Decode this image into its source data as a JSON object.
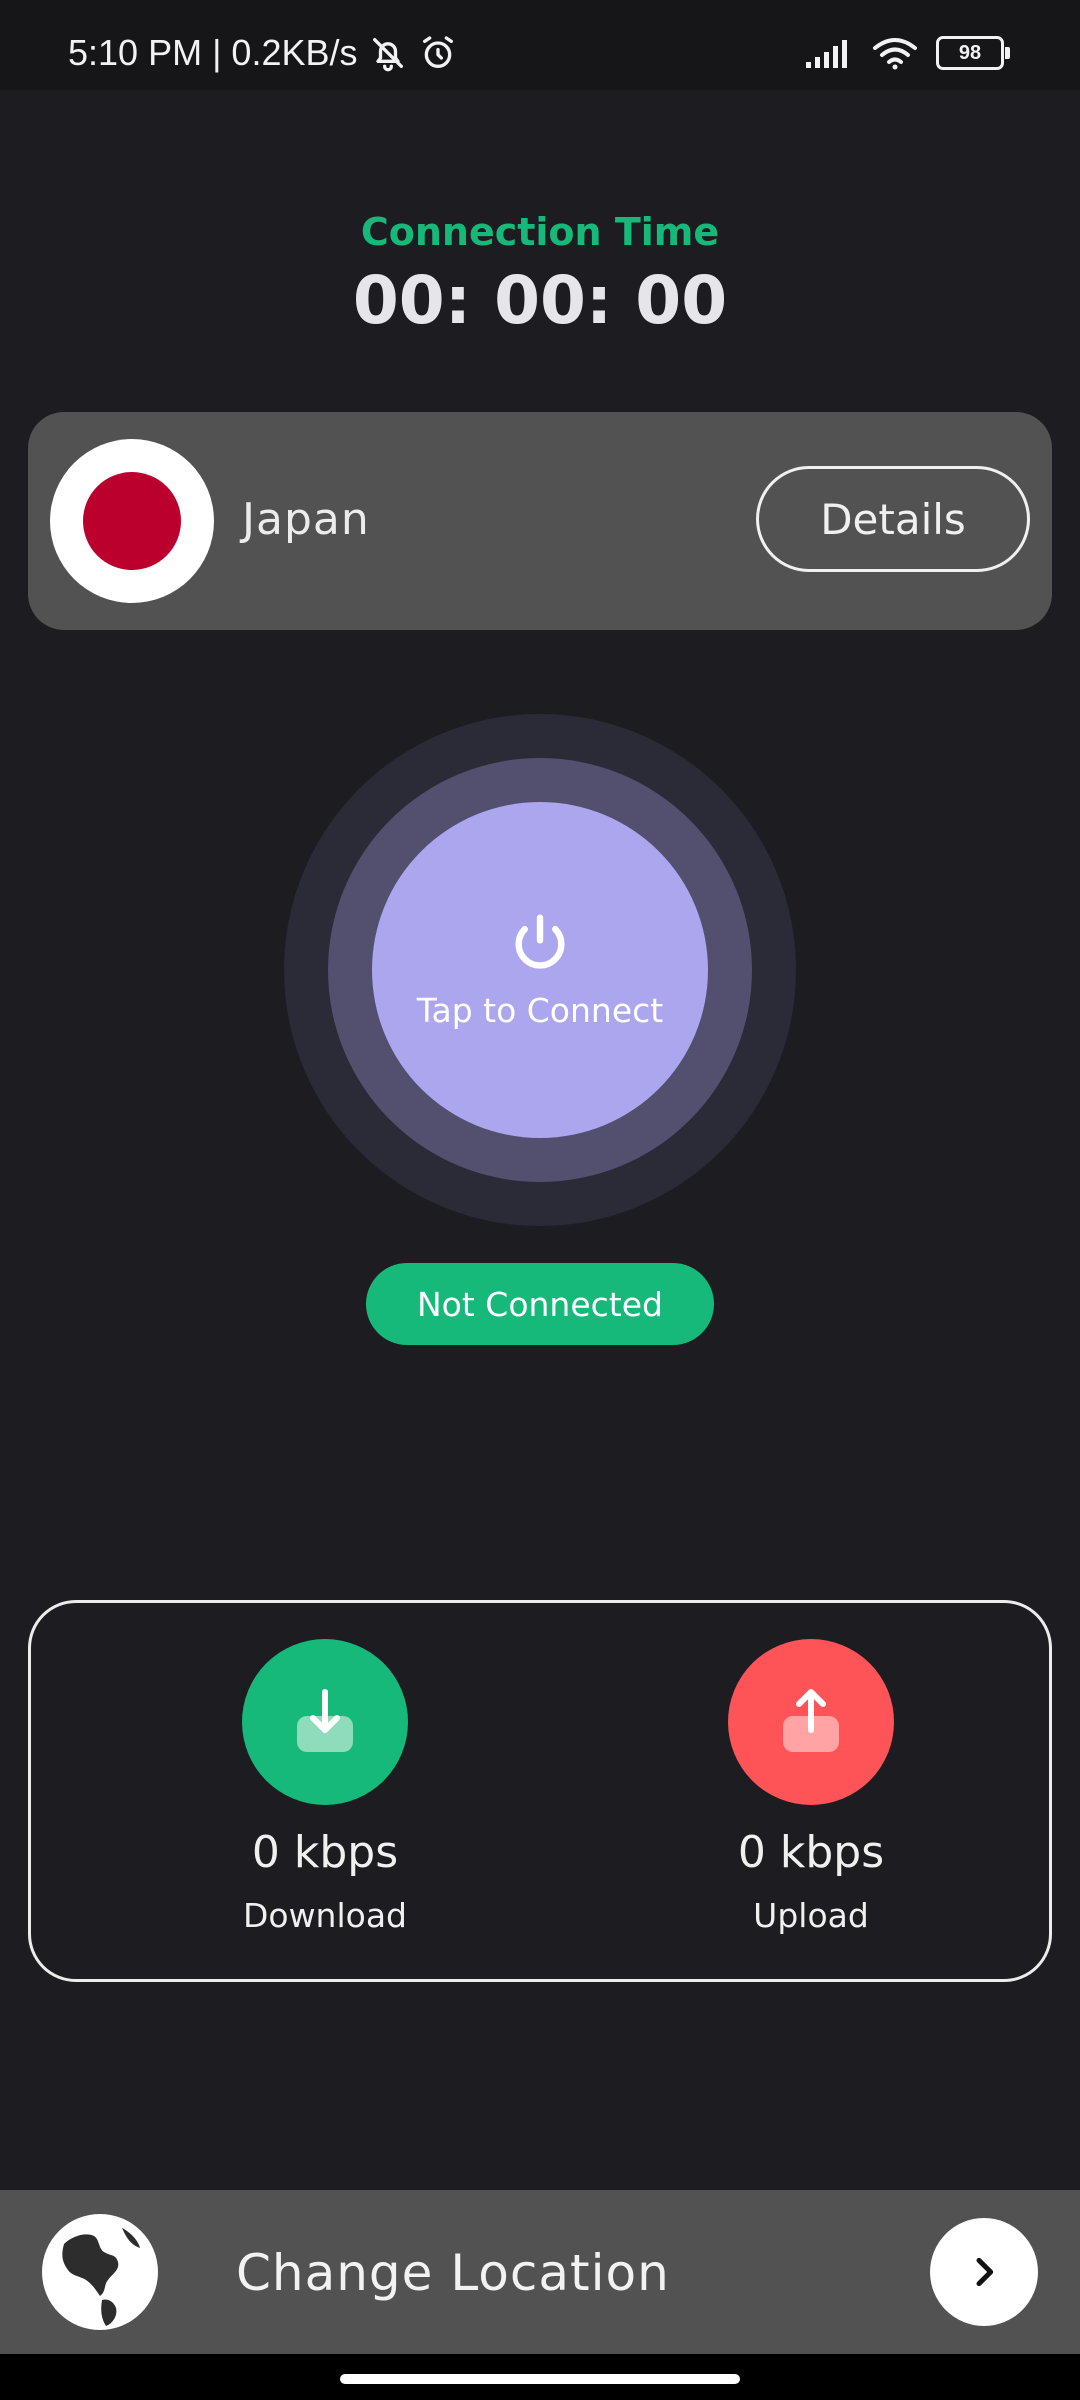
{
  "status_bar": {
    "time_speed": "5:10 PM | 0.2KB/s",
    "battery": "98",
    "icons": [
      "bell-off-icon",
      "alarm-icon",
      "signal-icon",
      "wifi-icon",
      "battery-icon"
    ]
  },
  "connection": {
    "time_label": "Connection Time",
    "time_value": "00: 00: 00",
    "status": "Not Connected"
  },
  "server": {
    "country": "Japan",
    "details_label": "Details",
    "flag_icon": "japan-flag-icon"
  },
  "connect_button": {
    "label": "Tap to Connect",
    "icon": "power-icon"
  },
  "stats": {
    "download": {
      "value": "0 kbps",
      "label": "Download",
      "icon": "download-icon"
    },
    "upload": {
      "value": "0 kbps",
      "label": "Upload",
      "icon": "upload-icon"
    }
  },
  "bottom_bar": {
    "label": "Change Location",
    "globe_icon": "globe-icon",
    "arrow_icon": "chevron-right-icon"
  },
  "colors": {
    "background": "#1d1d21",
    "accent_green": "#17b97a",
    "upload_red": "#fe5457",
    "connect_purple": "#aca6ef",
    "card_grey": "#525252"
  }
}
